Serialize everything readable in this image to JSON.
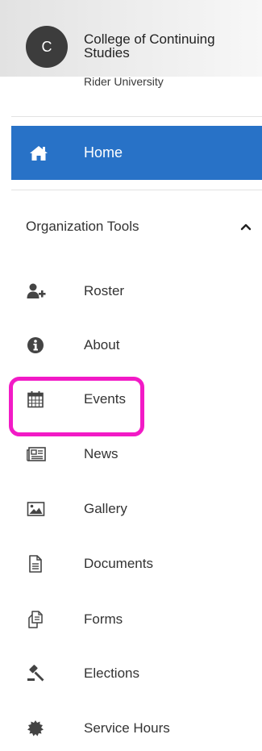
{
  "organization": {
    "avatar_letter": "C",
    "name": "College of Continuing Studies",
    "subtitle": "Rider University"
  },
  "nav": {
    "home": {
      "label": "Home",
      "icon": "home-icon",
      "active": true
    },
    "section": {
      "label": "Organization Tools",
      "expanded": true,
      "icon": "chevron-up-icon"
    },
    "items": [
      {
        "label": "Roster",
        "icon": "add-user-icon"
      },
      {
        "label": "About",
        "icon": "info-icon"
      },
      {
        "label": "Events",
        "icon": "calendar-icon",
        "highlighted": true
      },
      {
        "label": "News",
        "icon": "newspaper-icon"
      },
      {
        "label": "Gallery",
        "icon": "image-icon"
      },
      {
        "label": "Documents",
        "icon": "document-icon"
      },
      {
        "label": "Forms",
        "icon": "forms-icon"
      },
      {
        "label": "Elections",
        "icon": "gavel-icon"
      },
      {
        "label": "Service Hours",
        "icon": "badge-icon"
      }
    ]
  },
  "colors": {
    "active_background": "#2872c7",
    "highlight_outline": "#f21ac6",
    "avatar_background": "#3c3c3c",
    "text": "#333333"
  }
}
